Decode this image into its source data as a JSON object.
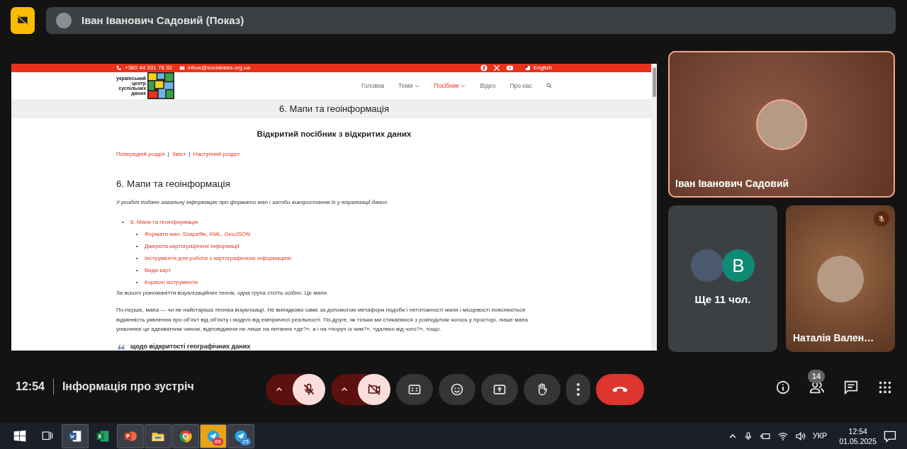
{
  "top_bar": {
    "presenter": "Іван Іванович Садовий (Показ)"
  },
  "shared_screen": {
    "contact_bar": {
      "phone": "+380 44 331 78 32",
      "email": "inbox@socialdata.org.ua",
      "language": "English"
    },
    "logo_lines": [
      "український",
      "центр",
      "суспільних",
      "даних"
    ],
    "nav": [
      {
        "label": "Головна",
        "dropdown": false,
        "selected": false
      },
      {
        "label": "Теми",
        "dropdown": true,
        "selected": false
      },
      {
        "label": "Посібник",
        "dropdown": true,
        "selected": true
      },
      {
        "label": "Відео",
        "dropdown": false,
        "selected": false
      },
      {
        "label": "Про нас",
        "dropdown": false,
        "selected": false
      }
    ],
    "page_title": "6. Мапи та геоінформація",
    "guide_title": "Відкритий посібник з відкритих даних",
    "chapter_links": [
      "Попередній розділ",
      "Зміст",
      "Наступний розділ"
    ],
    "chapter_separator": "|",
    "heading": "6. Мапи та геоінформація",
    "intro": "У розділі подано загальну інформацію про формати мап і засоби використання їх у візуалізації даних.",
    "toc": [
      {
        "marker": "•",
        "label": "6. Мапи та геоінформація",
        "children": [
          {
            "marker": "•",
            "label": "Формати мап. Shapefile, KML, GeoJSON"
          },
          {
            "marker": "•",
            "label": "Джерела картографічної інформації"
          },
          {
            "marker": "•",
            "label": "Інструменти для роботи з картографічною інформацією"
          },
          {
            "marker": "•",
            "label": "Види карт"
          },
          {
            "marker": "•",
            "label": "Корисні інструменти"
          }
        ]
      }
    ],
    "paragraphs": [
      "За всього різноманіття візуалізаційних технік, одна група стоїть осібно. Це мапи.",
      "По-перше, мапа — чи не найстаріша техніка візуалізації. Не випадково саме за допомогою метафори подоби і нетотожності мапи і місцевості пояснюється відмінність уявлення про об’єкт від об’єкту і моделі від емпіричної реальності. По-друге, як тільки ми стикаємося з розподілом чогось у просторі, лише мапа унаочнює це адекватним чином, відповідаючи не лише на питання «де?», а і на «поруч із чим?», «далеко від чого?», тощо."
    ],
    "quote": "щодо відкритості географічних даних"
  },
  "tiles": [
    {
      "kind": "person",
      "name": "Іван Іванович Садовий",
      "speaking": true,
      "muted": false
    },
    {
      "kind": "others",
      "label": "Ще 11 чол.",
      "avatar_letter": "В"
    },
    {
      "kind": "person",
      "name": "Наталія Вален…",
      "speaking": false,
      "muted": true
    }
  ],
  "meeting_bar": {
    "time": "12:54",
    "info": "Інформація про зустріч",
    "mic_on": false,
    "camera_on": false,
    "participant_count": "14"
  },
  "taskbar": {
    "apps": [
      {
        "kind": "word",
        "open": true
      },
      {
        "kind": "excel",
        "open": false
      },
      {
        "kind": "powerpoint",
        "open": true
      },
      {
        "kind": "explorer",
        "open": true
      },
      {
        "kind": "chrome",
        "open": true
      },
      {
        "kind": "messenger",
        "open": true,
        "badge": "88"
      },
      {
        "kind": "telegram",
        "open": true,
        "badge": "25"
      }
    ],
    "language": "УКР",
    "time": "12:54",
    "date": "01.05.2025"
  }
}
